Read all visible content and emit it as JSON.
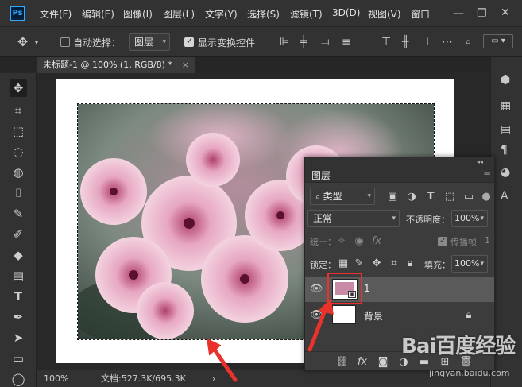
{
  "app": {
    "logo": "Ps"
  },
  "menu": [
    "文件(F)",
    "编辑(E)",
    "图像(I)",
    "图层(L)",
    "文字(Y)",
    "选择(S)",
    "滤镜(T)",
    "3D(D)",
    "视图(V)",
    "窗口"
  ],
  "options": {
    "auto_select_label": "自动选择：",
    "auto_select_checked": false,
    "auto_select_target": "图层",
    "show_transform_label": "显示变换控件",
    "show_transform_checked": true
  },
  "document_tab": {
    "title": "未标题-1 @ 100% (1, RGB/8) *",
    "close": "×"
  },
  "status": {
    "zoom": "100%",
    "doc_size": "文档:527.3K/695.3K",
    "arrow": "›"
  },
  "layers_panel": {
    "title": "图层",
    "collapse": "◂◂",
    "filter_kind": "类型",
    "blend_mode": "正常",
    "opacity_label": "不透明度：",
    "opacity_value": "100%",
    "unify_label": "统一：",
    "propagate_label": "传播帧",
    "propagate_value": "1",
    "lock_label": "锁定：",
    "fill_label": "填充：",
    "fill_value": "100%",
    "layers": [
      {
        "name": "1",
        "selected": true,
        "visible": true
      },
      {
        "name": "背景",
        "selected": false,
        "visible": true,
        "locked": true
      }
    ]
  },
  "colors": {
    "accent": "#31a8ff",
    "highlight_red": "#e8322b",
    "panel_bg": "#3c3c3c",
    "selected_layer": "#5a5a5a"
  },
  "watermark": {
    "text": "Bai百度经验",
    "url": "jingyan.baidu.com"
  }
}
